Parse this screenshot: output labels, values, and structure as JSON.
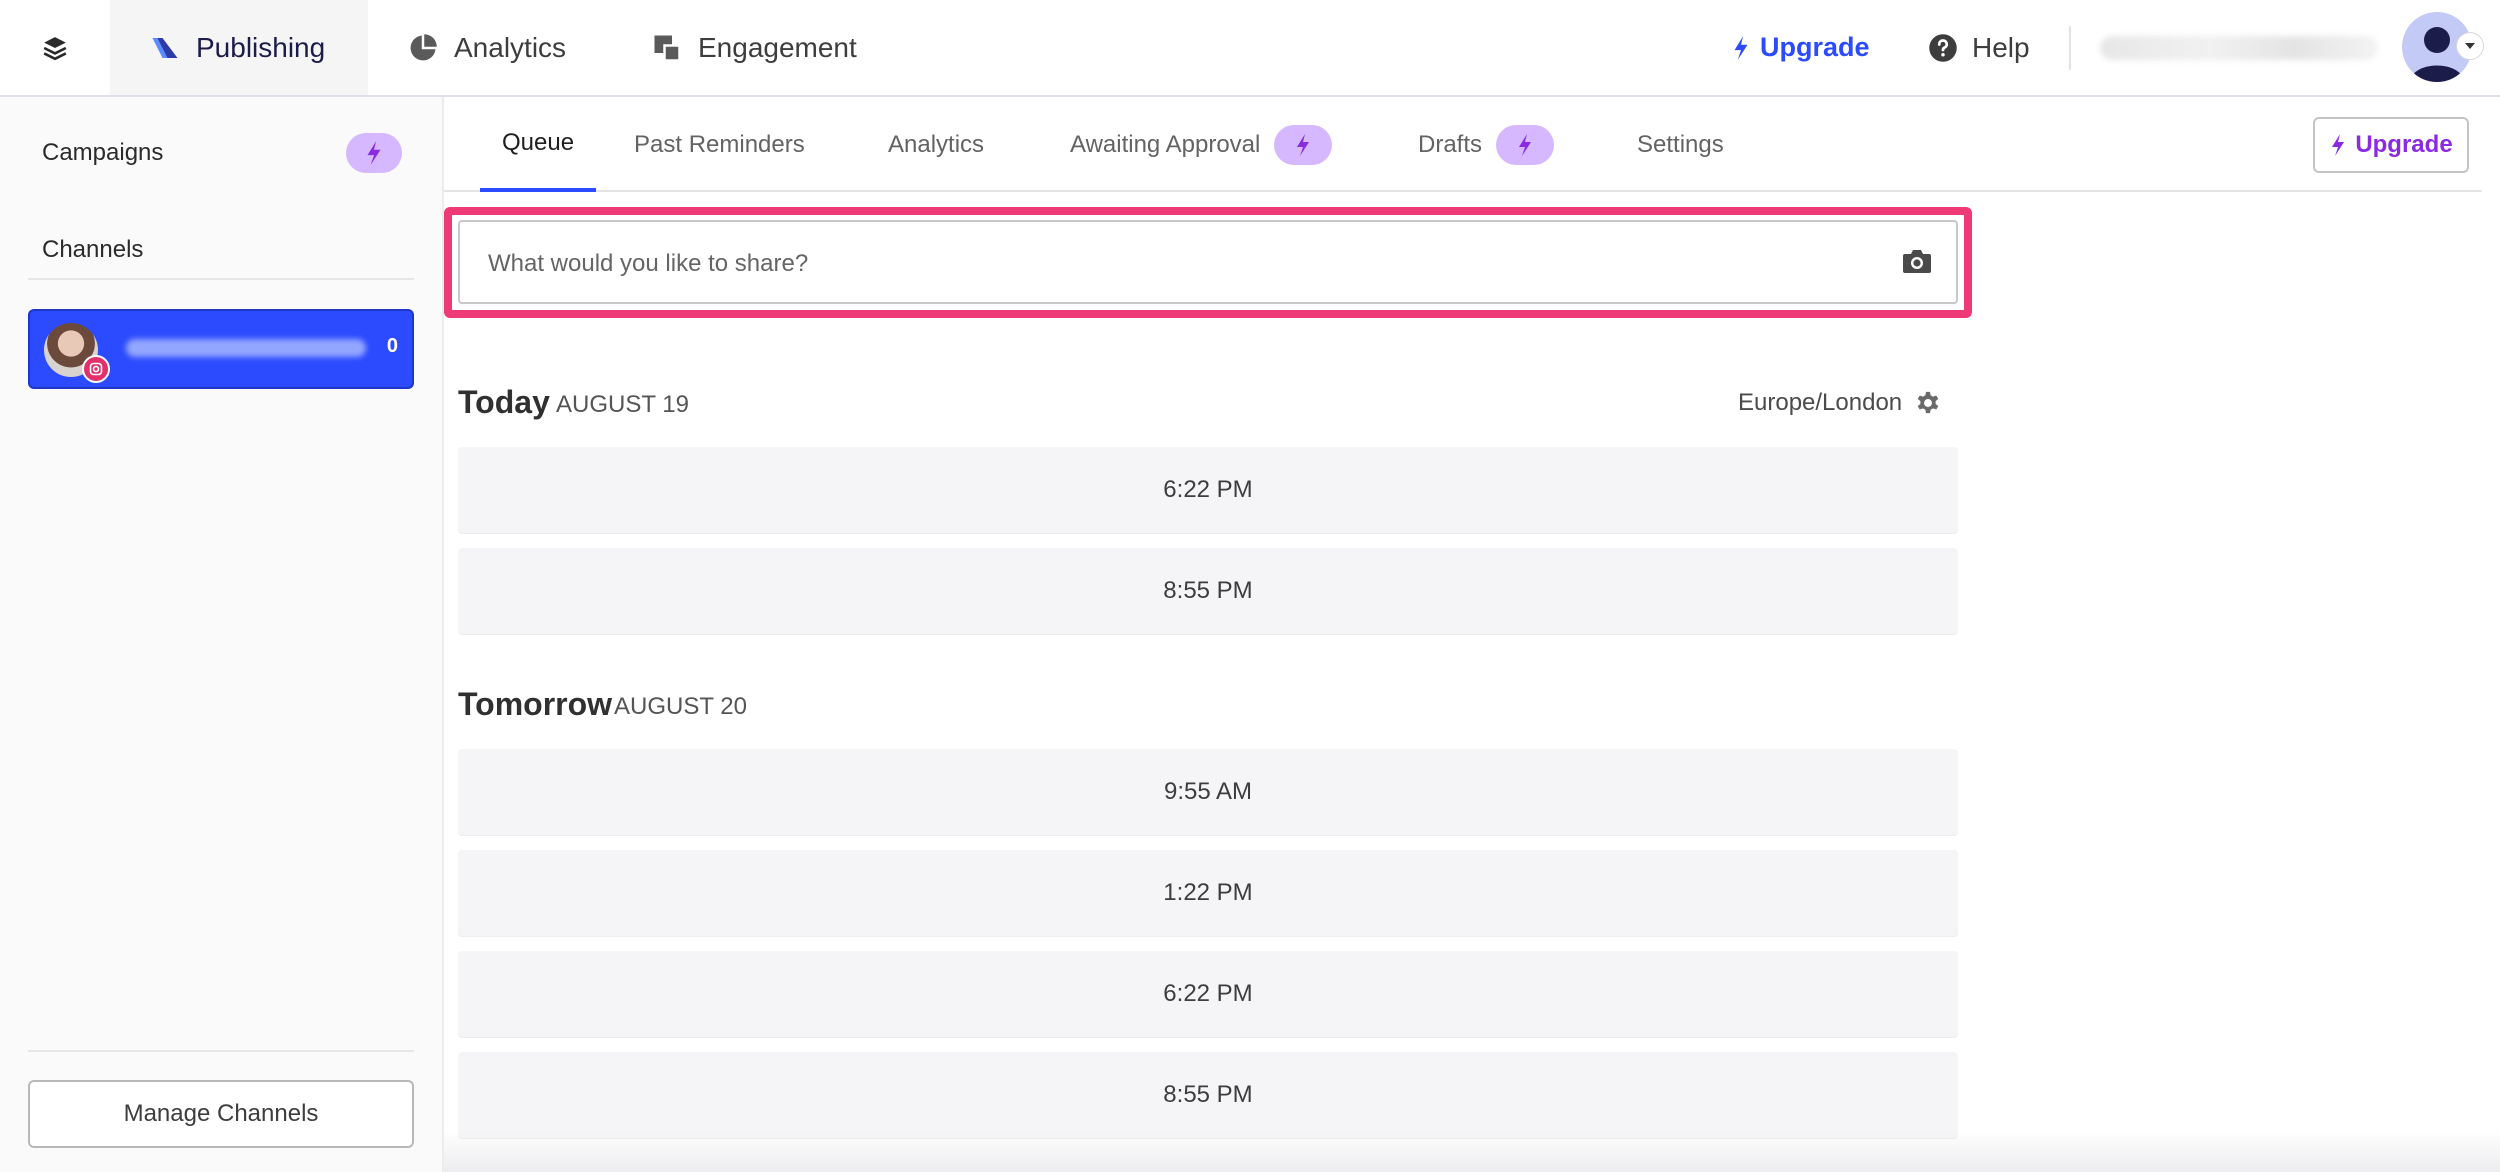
{
  "topnav": {
    "tabs": [
      {
        "label": "Publishing",
        "icon": "publishing-icon",
        "active": true
      },
      {
        "label": "Analytics",
        "icon": "pie-chart-icon",
        "active": false
      },
      {
        "label": "Engagement",
        "icon": "engagement-icon",
        "active": false
      }
    ],
    "upgrade_label": "Upgrade",
    "help_label": "Help"
  },
  "sidebar": {
    "campaigns_label": "Campaigns",
    "channels_label": "Channels",
    "channel": {
      "network": "instagram",
      "count": "0"
    },
    "manage_label": "Manage Channels"
  },
  "subtabs": [
    {
      "label": "Queue",
      "active": true,
      "bolt": false
    },
    {
      "label": "Past Reminders",
      "active": false,
      "bolt": false
    },
    {
      "label": "Analytics",
      "active": false,
      "bolt": false
    },
    {
      "label": "Awaiting Approval",
      "active": false,
      "bolt": true
    },
    {
      "label": "Drafts",
      "active": false,
      "bolt": true
    },
    {
      "label": "Settings",
      "active": false,
      "bolt": false
    }
  ],
  "subtab_upgrade_label": "Upgrade",
  "composer": {
    "placeholder": "What would you like to share?"
  },
  "queue": {
    "timezone": "Europe/London",
    "days": [
      {
        "title": "Today",
        "date": "AUGUST 19",
        "slots": [
          "6:22 PM",
          "8:55 PM"
        ]
      },
      {
        "title": "Tomorrow",
        "date": "AUGUST 20",
        "slots": [
          "9:55 AM",
          "1:22 PM",
          "6:22 PM",
          "8:55 PM"
        ]
      }
    ]
  },
  "colors": {
    "accent": "#2c4bff",
    "upgrade_purple": "#8a2be2",
    "bolt_pill": "#d5b8ff",
    "highlight": "#ef3a78"
  }
}
